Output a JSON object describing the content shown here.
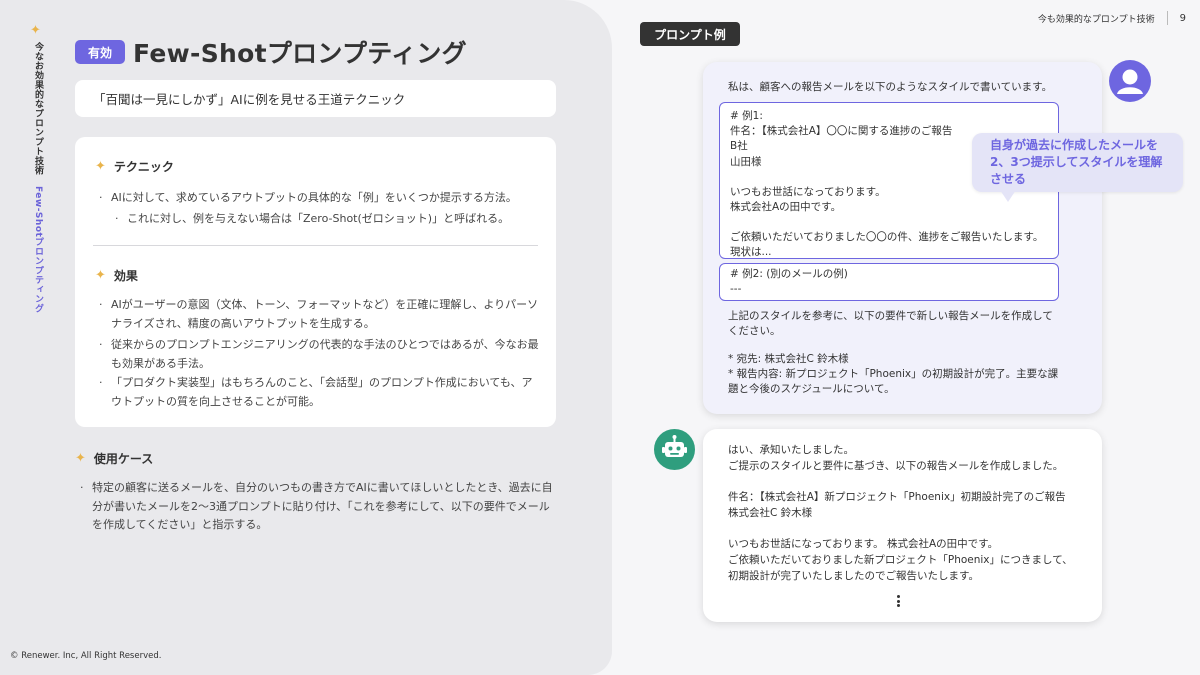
{
  "side": {
    "label_dark": "今なお効果的なプロンプト技術",
    "label_accent": "Few-Shotプロンプティング"
  },
  "header": {
    "badge": "有効",
    "title": "Few-Shotプロンプティング",
    "subtitle": "「百聞は一見にしかず」AIに例を見せる王道テクニック",
    "right_label": "今も効果的なプロンプト技術",
    "page_number": "9"
  },
  "technique": {
    "heading": "テクニック",
    "bullet1": "AIに対して、求めているアウトプットの具体的な「例」をいくつか提示する方法。",
    "bullet2": "これに対し、例を与えない場合は「Zero-Shot(ゼロショット)」と呼ばれる。"
  },
  "effects": {
    "heading": "効果",
    "items": [
      "AIがユーザーの意図（文体、トーン、フォーマットなど）を正確に理解し、よりパーソナライズされ、精度の高いアウトプットを生成する。",
      "従来からのプロンプトエンジニアリングの代表的な手法のひとつではあるが、今なお最も効果がある手法。",
      "「プロダクト実装型」はもちろんのこと、「会話型」のプロンプト作成においても、アウトプットの質を向上させることが可能。"
    ]
  },
  "use_case": {
    "heading": "使用ケース",
    "text": "特定の顧客に送るメールを、自分のいつもの書き方でAIに書いてほしいとしたとき、過去に自分が書いたメールを2〜3通プロンプトに貼り付け、「これを参考にして、以下の要件でメールを作成してください」と指示する。"
  },
  "copyright": "© Renewer. Inc, All Right Reserved.",
  "example": {
    "tag": "プロンプト例",
    "user": {
      "intro": "私は、顧客への報告メールを以下のようなスタイルで書いています。",
      "example1": [
        "# 例1:",
        "件名：【株式会社A】〇〇に関する進捗のご報告",
        "B社",
        "山田様",
        "",
        "いつもお世話になっております。",
        "株式会社Aの田中です。",
        "",
        "ご依頼いただいておりました〇〇の件、進捗をご報告いたします。",
        "現状は..."
      ],
      "example2": [
        "# 例2: (別のメールの例)",
        "---"
      ],
      "request": [
        "上記のスタイルを参考に、以下の要件で新しい報告メールを作成して",
        "ください。"
      ],
      "requirements": [
        "* 宛先: 株式会社C 鈴木様",
        "* 報告内容: 新プロジェクト「Phoenix」の初期設計が完了。主要な課",
        "題と今後のスケジュールについて。"
      ]
    },
    "tip": "自身が過去に作成したメールを2、3つ提示してスタイルを理解させる",
    "assistant": [
      "はい、承知いたしました。",
      " ご提示のスタイルと要件に基づき、以下の報告メールを作成しました。",
      "",
      "件名：【株式会社A】新プロジェクト「Phoenix」初期設計完了のご報告",
      "株式会社C 鈴木様",
      "",
      "いつもお世話になっております。 株式会社Aの田中です。",
      "ご依頼いただいておりました新プロジェクト「Phoenix」につきまして、",
      "初期設計が完了いたしましたのでご報告いたします。"
    ]
  },
  "colors": {
    "accent": "#6e66e0",
    "star": "#e9b44c",
    "bot": "#2f9e7e",
    "panel": "#e9e9ec"
  }
}
